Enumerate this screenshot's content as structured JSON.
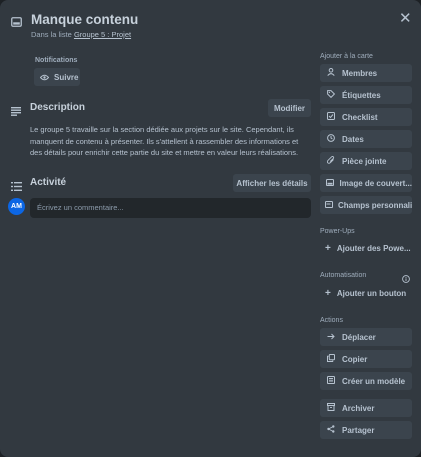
{
  "card": {
    "title": "Manque contenu",
    "list_prefix": "Dans la liste",
    "list_name": "Groupe 5 : Projet"
  },
  "notifications": {
    "heading": "Notifications",
    "follow_label": "Suivre"
  },
  "description": {
    "heading": "Description",
    "edit_label": "Modifier",
    "text": "Le groupe 5 travaille sur la section dédiée aux projets sur le site. Cependant, ils manquent de contenu à présenter. Ils s'attellent à rassembler des informations et des détails pour enrichir cette partie du site et mettre en valeur leurs réalisations."
  },
  "activity": {
    "heading": "Activité",
    "details_label": "Afficher les détails",
    "avatar_initials": "AM",
    "comment_placeholder": "Écrivez un commentaire..."
  },
  "sidebar": {
    "add_heading": "Ajouter à la carte",
    "add_items": [
      {
        "label": "Membres",
        "icon": "user-icon"
      },
      {
        "label": "Étiquettes",
        "icon": "tag-icon"
      },
      {
        "label": "Checklist",
        "icon": "checklist-icon"
      },
      {
        "label": "Dates",
        "icon": "clock-icon"
      },
      {
        "label": "Pièce jointe",
        "icon": "paperclip-icon"
      },
      {
        "label": "Image de couvert...",
        "icon": "cover-image-icon"
      },
      {
        "label": "Champs personnali...",
        "icon": "custom-fields-icon"
      }
    ],
    "powerups_heading": "Power-Ups",
    "powerups_add": "Ajouter des Powe...",
    "automation_heading": "Automatisation",
    "automation_add": "Ajouter un bouton",
    "actions_heading": "Actions",
    "actions": [
      {
        "label": "Déplacer",
        "icon": "arrow-right-icon"
      },
      {
        "label": "Copier",
        "icon": "copy-icon"
      },
      {
        "label": "Créer un modèle",
        "icon": "template-icon"
      },
      {
        "label": "Archiver",
        "icon": "archive-icon"
      },
      {
        "label": "Partager",
        "icon": "share-icon"
      }
    ]
  }
}
